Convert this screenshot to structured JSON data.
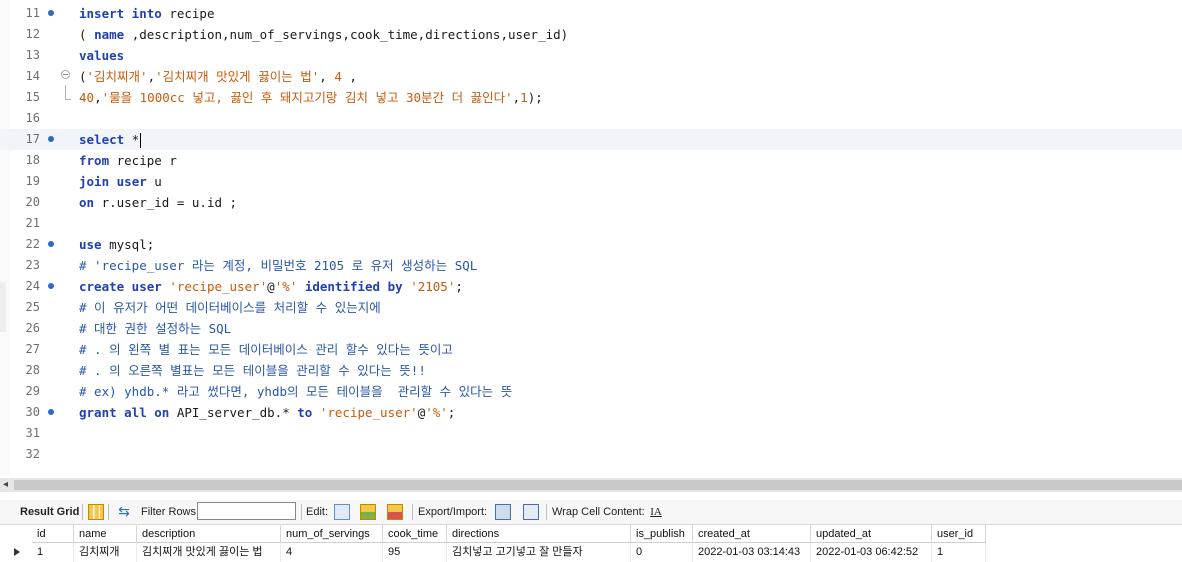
{
  "editor": {
    "lines": [
      {
        "n": "11",
        "dot": true,
        "tokens": [
          {
            "t": "insert into",
            "c": "kw"
          },
          {
            "t": " recipe",
            "c": ""
          }
        ]
      },
      {
        "n": "12",
        "dot": false,
        "tokens": [
          {
            "t": "( ",
            "c": ""
          },
          {
            "t": "name",
            "c": "kw"
          },
          {
            "t": " ,description,num_of_servings,cook_time,directions,user_id)",
            "c": ""
          }
        ]
      },
      {
        "n": "13",
        "dot": false,
        "tokens": [
          {
            "t": "values",
            "c": "kw"
          }
        ]
      },
      {
        "n": "14",
        "dot": false,
        "fold": true,
        "tokens": [
          {
            "t": "(",
            "c": ""
          },
          {
            "t": "'김치찌개'",
            "c": "str"
          },
          {
            "t": ",",
            "c": ""
          },
          {
            "t": "'김치찌개 맛있게 끓이는 법'",
            "c": "str"
          },
          {
            "t": ", ",
            "c": ""
          },
          {
            "t": "4",
            "c": "num"
          },
          {
            "t": " ,",
            "c": ""
          }
        ]
      },
      {
        "n": "15",
        "dot": false,
        "tokens": [
          {
            "t": "40",
            "c": "num"
          },
          {
            "t": ",",
            "c": ""
          },
          {
            "t": "'물을 1000cc 넣고, 끓인 후 돼지고기랑 김치 넣고 30분간 더 끓인다'",
            "c": "str"
          },
          {
            "t": ",",
            "c": ""
          },
          {
            "t": "1",
            "c": "num"
          },
          {
            "t": ");",
            "c": ""
          }
        ]
      },
      {
        "n": "16",
        "dot": false,
        "tokens": []
      },
      {
        "n": "17",
        "dot": true,
        "current": true,
        "caret": true,
        "tokens": [
          {
            "t": "select",
            "c": "kw"
          },
          {
            "t": " *",
            "c": ""
          }
        ]
      },
      {
        "n": "18",
        "dot": false,
        "tokens": [
          {
            "t": "from",
            "c": "kw"
          },
          {
            "t": " recipe r",
            "c": ""
          }
        ]
      },
      {
        "n": "19",
        "dot": false,
        "tokens": [
          {
            "t": "join",
            "c": "kw"
          },
          {
            "t": " ",
            "c": ""
          },
          {
            "t": "user",
            "c": "kw"
          },
          {
            "t": " u",
            "c": ""
          }
        ]
      },
      {
        "n": "20",
        "dot": false,
        "tokens": [
          {
            "t": "on",
            "c": "kw"
          },
          {
            "t": " r.user_id = u.id ;",
            "c": ""
          }
        ]
      },
      {
        "n": "21",
        "dot": false,
        "tokens": []
      },
      {
        "n": "22",
        "dot": true,
        "tokens": [
          {
            "t": "use",
            "c": "kw"
          },
          {
            "t": " mysql;",
            "c": ""
          }
        ]
      },
      {
        "n": "23",
        "dot": false,
        "tokens": [
          {
            "t": "# 'recipe_user 라는 계정, 비밀번호 2105 로 유저 생성하는 SQL",
            "c": "cm"
          }
        ]
      },
      {
        "n": "24",
        "dot": true,
        "tokens": [
          {
            "t": "create user",
            "c": "kw"
          },
          {
            "t": " ",
            "c": ""
          },
          {
            "t": "'recipe_user'",
            "c": "str"
          },
          {
            "t": "@",
            "c": ""
          },
          {
            "t": "'%'",
            "c": "str"
          },
          {
            "t": " ",
            "c": ""
          },
          {
            "t": "identified by",
            "c": "kw"
          },
          {
            "t": " ",
            "c": ""
          },
          {
            "t": "'2105'",
            "c": "str"
          },
          {
            "t": ";",
            "c": ""
          }
        ]
      },
      {
        "n": "25",
        "dot": false,
        "tokens": [
          {
            "t": "# 이 유저가 어떤 데이터베이스를 처리할 수 있는지에",
            "c": "cm"
          }
        ]
      },
      {
        "n": "26",
        "dot": false,
        "tokens": [
          {
            "t": "# 대한 권한 설정하는 SQL",
            "c": "cm"
          }
        ]
      },
      {
        "n": "27",
        "dot": false,
        "tokens": [
          {
            "t": "# . 의 왼쪽 별 표는 모든 데이터베이스 관리 할수 있다는 뜻이고",
            "c": "cm"
          }
        ]
      },
      {
        "n": "28",
        "dot": false,
        "tokens": [
          {
            "t": "# . 의 오른쪽 별표는 모든 테이블을 관리할 수 있다는 뜻!!",
            "c": "cm"
          }
        ]
      },
      {
        "n": "29",
        "dot": false,
        "tokens": [
          {
            "t": "# ex) yhdb.* 라고 썼다면, yhdb의 모든 테이블을  관리할 수 있다는 뜻",
            "c": "cm"
          }
        ]
      },
      {
        "n": "30",
        "dot": true,
        "tokens": [
          {
            "t": "grant all on",
            "c": "kw"
          },
          {
            "t": " API_server_db.* ",
            "c": ""
          },
          {
            "t": "to",
            "c": "kw"
          },
          {
            "t": " ",
            "c": ""
          },
          {
            "t": "'recipe_user'",
            "c": "str"
          },
          {
            "t": "@",
            "c": ""
          },
          {
            "t": "'%'",
            "c": "str"
          },
          {
            "t": ";",
            "c": ""
          }
        ]
      },
      {
        "n": "31",
        "dot": false,
        "tokens": []
      },
      {
        "n": "32",
        "dot": false,
        "tokens": []
      }
    ]
  },
  "toolbar": {
    "result_grid": "Result Grid",
    "filter_rows": "Filter Rows:",
    "filter_value": "",
    "edit": "Edit:",
    "export_import": "Export/Import:",
    "wrap_cell": "Wrap Cell Content:"
  },
  "grid": {
    "columns": [
      "id",
      "name",
      "description",
      "num_of_servings",
      "cook_time",
      "directions",
      "is_publish",
      "created_at",
      "updated_at",
      "user_id"
    ],
    "rows": [
      [
        "1",
        "김치찌개",
        "김치찌개 맛있게 끓이는 법",
        "4",
        "95",
        "김치넣고 고기넣고 잘 만들자",
        "0",
        "2022-01-03 03:14:43",
        "2022-01-03 06:42:52",
        "1"
      ]
    ]
  },
  "colors": {
    "keyword": "#1f3fb5",
    "string": "#c75b0b",
    "comment": "#2a57a8",
    "breakpoint_dot": "#2a6bc9"
  }
}
